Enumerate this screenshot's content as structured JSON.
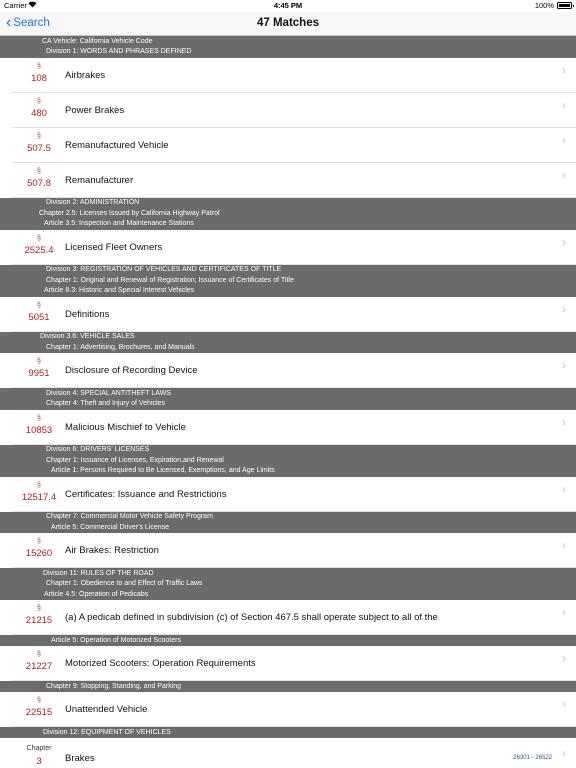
{
  "status": {
    "carrier": "Carrier",
    "time": "4:45 PM",
    "battery": "100%"
  },
  "nav": {
    "back_label": "Search",
    "title": "47 Matches"
  },
  "section_symbol": "§",
  "disclosure_icon": "›",
  "items": [
    {
      "type": "header",
      "lines": [
        {
          "text": "CA Vehicle: California Vehicle Code",
          "indent": 42
        },
        {
          "text": "Division 1: WORDS AND PHRASES DEFINED",
          "indent": 46
        }
      ]
    },
    {
      "type": "row",
      "num": "108",
      "label": "Airbrakes"
    },
    {
      "type": "row",
      "num": "480",
      "label": "Power Brakes"
    },
    {
      "type": "row",
      "num": "507.5",
      "label": "Remanufactured Vehicle"
    },
    {
      "type": "row",
      "num": "507.8",
      "label": "Remanufacturer"
    },
    {
      "type": "header",
      "lines": [
        {
          "text": "Division 2: ADMINISTRATION",
          "indent": 46
        },
        {
          "text": "Chapter 2.5: Licenses Issued by California Highway Patrol",
          "indent": 39
        },
        {
          "text": "Article 3.5: Inspection and Maintenance Stations",
          "indent": 44
        }
      ]
    },
    {
      "type": "row",
      "num": "2525.4",
      "label": "Licensed Fleet Owners"
    },
    {
      "type": "header",
      "lines": [
        {
          "text": "Division 3: REGISTRATION OF VEHICLES AND CERTIFICATES OF TITLE",
          "indent": 46
        },
        {
          "text": "Chapter 1: Original and Renewal of Registration; Issuance of Certificates of Title",
          "indent": 46
        },
        {
          "text": "Article 8.3: Historic and Special Interest Vehicles",
          "indent": 44
        }
      ]
    },
    {
      "type": "row",
      "num": "5051",
      "label": "Definitions"
    },
    {
      "type": "header",
      "lines": [
        {
          "text": "Division 3.6: VEHICLE SALES",
          "indent": 40
        },
        {
          "text": "Chapter 1: Advertising, Brochures, and Manuals",
          "indent": 46
        }
      ]
    },
    {
      "type": "row",
      "num": "9951",
      "label": "Disclosure of Recording Device"
    },
    {
      "type": "header",
      "lines": [
        {
          "text": "Division 4: SPECIAL ANTITHEFT LAWS",
          "indent": 46
        },
        {
          "text": "Chapter 4: Theft and Injury of Vehicles",
          "indent": 46
        }
      ]
    },
    {
      "type": "row",
      "num": "10853",
      "label": "Malicious Mischief to Vehicle"
    },
    {
      "type": "header",
      "lines": [
        {
          "text": "Division 6: DRIVERS' LICENSES",
          "indent": 46
        },
        {
          "text": "Chapter 1: Issuance of Licenses, Expiration,and Renewal",
          "indent": 46
        },
        {
          "text": "Article 1: Persons Required to Be Licensed, Exemptions, and Age Limits",
          "indent": 51
        }
      ]
    },
    {
      "type": "row",
      "num": "12517.4",
      "label": "Certificates: Issuance and Restrictions"
    },
    {
      "type": "header",
      "lines": [
        {
          "text": "Chapter 7: Commercial Motor Vehicle Safety Program",
          "indent": 46
        },
        {
          "text": "Article 5: Commercial Driver's License",
          "indent": 51
        }
      ]
    },
    {
      "type": "row",
      "num": "15260",
      "label": "Air Brakes: Restriction"
    },
    {
      "type": "header",
      "lines": [
        {
          "text": "Division 11: RULES OF THE ROAD",
          "indent": 43
        },
        {
          "text": "Chapter 1: Obedience to and Effect of Traffic Laws",
          "indent": 46
        },
        {
          "text": "Article 4.5: Operation of Pedicabs",
          "indent": 44
        }
      ]
    },
    {
      "type": "row",
      "num": "21215",
      "label": "(a) A pedicab defined in subdivision (c) of Section 467.5 shall operate subject to all of the"
    },
    {
      "type": "header",
      "lines": [
        {
          "text": "Article 5: Operation of Motorized Scooters",
          "indent": 51
        }
      ]
    },
    {
      "type": "row",
      "num": "21227",
      "label": "Motorized Scooters: Operation Requirements"
    },
    {
      "type": "header",
      "lines": [
        {
          "text": "Chapter 9: Stopping, Standing, and Parking",
          "indent": 46
        }
      ]
    },
    {
      "type": "row",
      "num": "22515",
      "label": "Unattended Vehicle"
    },
    {
      "type": "header",
      "lines": [
        {
          "text": "Division 12: EQUIPMENT OF VEHICLES",
          "indent": 43
        }
      ]
    },
    {
      "type": "chapter-row",
      "caption": "Chapter",
      "num": "3",
      "label": "Brakes",
      "range": "26301 - 26522"
    }
  ]
}
